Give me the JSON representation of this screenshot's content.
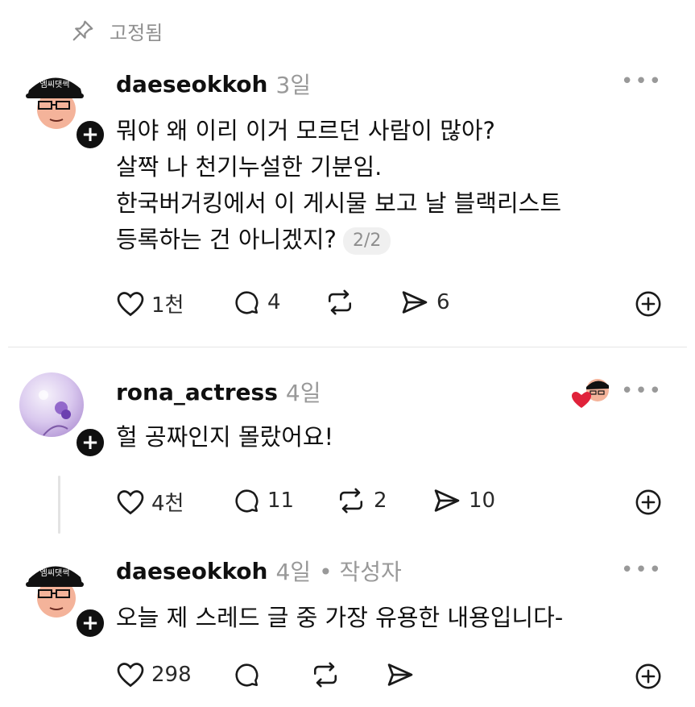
{
  "pinned": {
    "label": "고정됨"
  },
  "posts": [
    {
      "username": "daeseokkoh",
      "time": "3일",
      "lines": [
        "뭐야 왜 이리 이거 모르던 사람이 많아?",
        "살짝 나 천기누설한 기분임.",
        "한국버거킹에서 이 게시물 보고 날 블랙리스트",
        "등록하는 건 아니겠지?"
      ],
      "badge": "2/2",
      "avatar_text": "엠씨댓썩",
      "actions": {
        "likes": "1천",
        "comments": "4",
        "reposts": "",
        "shares": "6"
      }
    },
    {
      "username": "rona_actress",
      "time": "4일",
      "lines": [
        "헐 공짜인지 몰랐어요!"
      ],
      "actions": {
        "likes": "4천",
        "comments": "11",
        "reposts": "2",
        "shares": "10"
      }
    },
    {
      "username": "daeseokkoh",
      "time": "4일",
      "author_tag": "• 작성자",
      "lines": [
        "오늘 제 스레드 글 중 가장 유용한 내용입니다-"
      ],
      "avatar_text": "엠씨댓썩",
      "actions": {
        "likes": "298",
        "comments": "",
        "reposts": "",
        "shares": ""
      }
    }
  ],
  "colors": {
    "text": "#101010",
    "muted": "#999999",
    "divider": "#e6e6e6",
    "heart": "#e0223a"
  },
  "icons": [
    "pin-icon",
    "heart-icon",
    "comment-icon",
    "repost-icon",
    "share-icon",
    "add-circle-icon",
    "more-icon"
  ]
}
